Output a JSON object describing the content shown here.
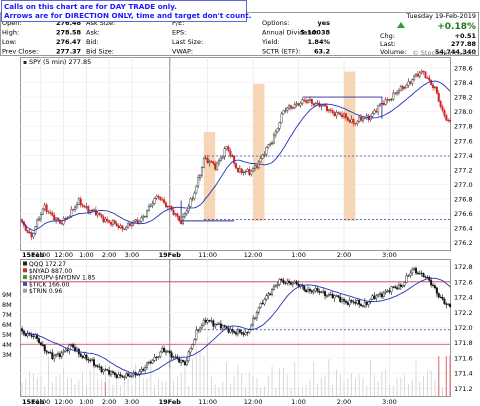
{
  "annotation": {
    "line1": "Calls on this chart are for DAY TRADE only.",
    "line2": "Arrows are for DIRECTION ONLY, time and target don't count."
  },
  "header": {
    "date": "Tuesday 19-Feb-2019",
    "pct_change": "+0.18%",
    "chg_label": "Chg:",
    "chg_value": "+0.51",
    "last_label": "Last:",
    "last_value": "277.88",
    "volume_label": "Volume:",
    "volume_value": "54,744,340",
    "rows": [
      {
        "l1": "Open:",
        "v1": "276.48",
        "l2": "Ask Size:",
        "v2": "",
        "l3": "P/E:",
        "v3": "",
        "l4": "Options:",
        "v4": "yes"
      },
      {
        "l1": "High:",
        "v1": "278.58",
        "l2": "Ask:",
        "v2": "",
        "l3": "EPS:",
        "v3": "",
        "l4": "Annual Dividend:",
        "v4": "5.10038"
      },
      {
        "l1": "Low:",
        "v1": "276.47",
        "l2": "Bid:",
        "v2": "",
        "l3": "Last Size:",
        "v3": "",
        "l4": "Yield:",
        "v4": "1.84%"
      },
      {
        "l1": "Prev Close:",
        "v1": "277.37",
        "l2": "Bid Size:",
        "v2": "",
        "l3": "VWAP:",
        "v3": "",
        "l4": "SCTR (ETF):",
        "v4": "63.2"
      }
    ]
  },
  "watermark": "© StockCharts.com",
  "panels": {
    "price_label": "SPY (5 min) 277.85",
    "lower_labels": [
      "QQQ 172.27",
      "$NYAD 887.00",
      "$NYUPV-$NYDNV 1.85",
      "$TICK 166.00",
      "$TRIN 0.96"
    ]
  },
  "colors": {
    "up": "#222222",
    "down": "#d42020",
    "ma": "#2233bb",
    "band": "#f5cfa8",
    "guide": "#2a2a99",
    "hline": "#cc3355"
  },
  "chart_data": [
    {
      "type": "candlestick",
      "series_name": "SPY (5 min)",
      "x_ticks": [
        "15Feb",
        "11:00",
        "12:00",
        "1:00",
        "2:00",
        "3:00",
        "19Feb",
        "11:00",
        "12:00",
        "1:00",
        "2:00",
        "3:00"
      ],
      "y_ticks": [
        276.2,
        276.4,
        276.6,
        276.8,
        277.0,
        277.2,
        277.4,
        277.6,
        277.8,
        278.0,
        278.2,
        278.4,
        278.6
      ],
      "ylim": [
        276.1,
        278.75
      ],
      "close_anchors": [
        [
          0,
          276.45
        ],
        [
          5,
          276.3
        ],
        [
          12,
          276.7
        ],
        [
          20,
          276.45
        ],
        [
          30,
          276.75
        ],
        [
          42,
          276.55
        ],
        [
          52,
          276.4
        ],
        [
          62,
          276.5
        ],
        [
          72,
          276.85
        ],
        [
          80,
          276.6
        ],
        [
          84,
          276.5
        ],
        [
          90,
          276.8
        ],
        [
          96,
          277.35
        ],
        [
          102,
          277.25
        ],
        [
          108,
          277.5
        ],
        [
          114,
          277.2
        ],
        [
          120,
          277.15
        ],
        [
          126,
          277.35
        ],
        [
          132,
          277.6
        ],
        [
          138,
          278.0
        ],
        [
          144,
          278.1
        ],
        [
          152,
          278.15
        ],
        [
          160,
          278.05
        ],
        [
          168,
          277.95
        ],
        [
          176,
          277.85
        ],
        [
          184,
          277.95
        ],
        [
          192,
          278.15
        ],
        [
          200,
          278.3
        ],
        [
          206,
          278.45
        ],
        [
          212,
          278.55
        ],
        [
          218,
          278.3
        ],
        [
          222,
          278.0
        ],
        [
          226,
          277.85
        ]
      ],
      "dashed_levels": [
        277.39,
        276.52
      ],
      "support_level": 276.5,
      "resistance_level": 278.2
    },
    {
      "type": "candlestick",
      "series_name": "QQQ",
      "last": 172.27,
      "y_ticks": [
        171.2,
        171.4,
        171.6,
        171.8,
        172.0,
        172.2,
        172.4,
        172.6,
        172.8
      ],
      "ylim": [
        171.1,
        172.9
      ],
      "close_anchors": [
        [
          0,
          171.95
        ],
        [
          8,
          171.85
        ],
        [
          16,
          171.6
        ],
        [
          26,
          171.75
        ],
        [
          36,
          171.55
        ],
        [
          46,
          171.4
        ],
        [
          56,
          171.35
        ],
        [
          64,
          171.45
        ],
        [
          74,
          171.7
        ],
        [
          82,
          171.6
        ],
        [
          86,
          171.5
        ],
        [
          92,
          171.95
        ],
        [
          98,
          172.1
        ],
        [
          106,
          172.0
        ],
        [
          112,
          171.95
        ],
        [
          118,
          171.9
        ],
        [
          124,
          172.2
        ],
        [
          130,
          172.45
        ],
        [
          136,
          172.6
        ],
        [
          142,
          172.6
        ],
        [
          150,
          172.5
        ],
        [
          160,
          172.45
        ],
        [
          170,
          172.35
        ],
        [
          180,
          172.3
        ],
        [
          190,
          172.45
        ],
        [
          200,
          172.55
        ],
        [
          206,
          172.75
        ],
        [
          212,
          172.7
        ],
        [
          218,
          172.5
        ],
        [
          224,
          172.3
        ],
        [
          226,
          172.25
        ]
      ],
      "red_levels": [
        172.6,
        171.78
      ],
      "dashed_levels": [
        171.97
      ],
      "left_ticks": [
        "9M",
        "8M",
        "7M",
        "6M",
        "5M",
        "4M",
        "3M"
      ]
    }
  ]
}
